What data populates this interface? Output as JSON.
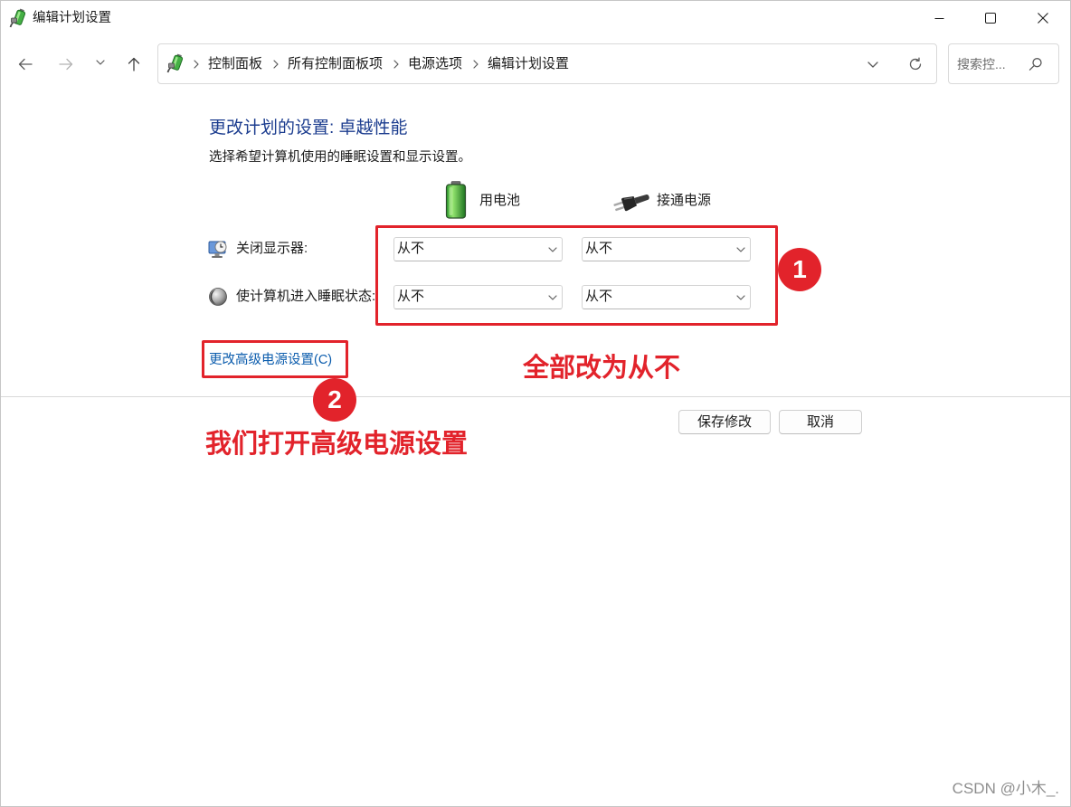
{
  "window": {
    "title": "编辑计划设置",
    "app_icon": "power-options-icon",
    "controls": [
      "minimize-icon",
      "maximize-icon",
      "close-icon"
    ]
  },
  "nav": {
    "icons": [
      "arrow-left-icon",
      "arrow-right-icon",
      "chevron-down-icon",
      "arrow-up-icon",
      "refresh-icon",
      "search-icon"
    ],
    "breadcrumb": [
      "控制面板",
      "所有控制面板项",
      "电源选项",
      "编辑计划设置"
    ],
    "search": {
      "placeholder": "搜索控..."
    }
  },
  "plan": {
    "heading": "更改计划的设置: 卓越性能",
    "description": "选择希望计算机使用的睡眠设置和显示设置。",
    "columns": [
      {
        "label": "用电池",
        "icon": "battery-icon"
      },
      {
        "label": "接通电源",
        "icon": "plug-icon"
      }
    ],
    "rows": [
      {
        "label": "关闭显示器:",
        "icon": "display-icon",
        "values": [
          "从不",
          "从不"
        ]
      },
      {
        "label": "使计算机进入睡眠状态:",
        "icon": "sleep-icon",
        "values": [
          "从不",
          "从不"
        ]
      }
    ],
    "advanced_link": "更改高级电源设置(C)"
  },
  "actions": {
    "save": "保存修改",
    "cancel": "取消"
  },
  "annotations": {
    "badges": [
      "1",
      "2"
    ],
    "notes": [
      "全部改为从不",
      "我们打开高级电源设置"
    ]
  },
  "watermark": "CSDN @小木_.",
  "theme": {
    "heading_color": "#1c3d8f",
    "link_color": "#0b5cad",
    "annotation_color": "#e2232b"
  }
}
